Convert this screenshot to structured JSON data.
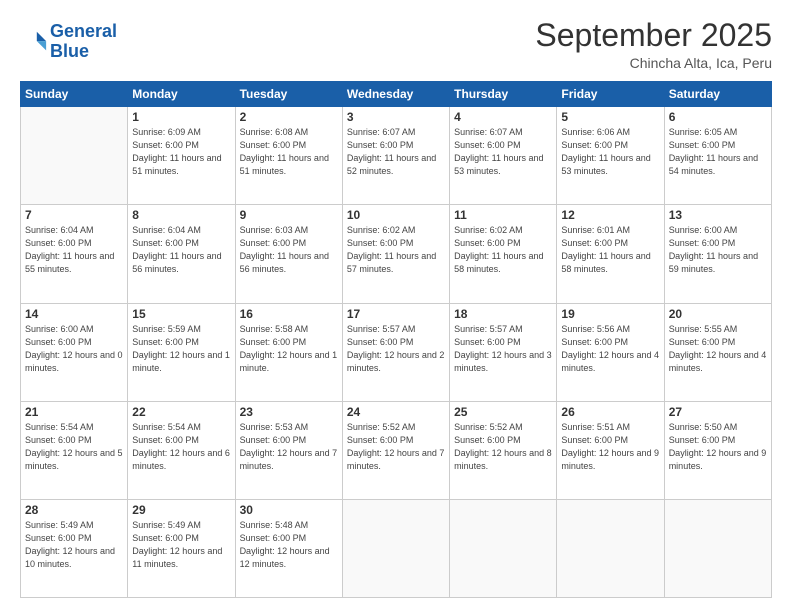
{
  "logo": {
    "line1": "General",
    "line2": "Blue"
  },
  "header": {
    "title": "September 2025",
    "subtitle": "Chincha Alta, Ica, Peru"
  },
  "weekdays": [
    "Sunday",
    "Monday",
    "Tuesday",
    "Wednesday",
    "Thursday",
    "Friday",
    "Saturday"
  ],
  "weeks": [
    [
      {
        "day": "",
        "empty": true
      },
      {
        "day": "1",
        "sunrise": "6:09 AM",
        "sunset": "6:00 PM",
        "daylight": "11 hours and 51 minutes."
      },
      {
        "day": "2",
        "sunrise": "6:08 AM",
        "sunset": "6:00 PM",
        "daylight": "11 hours and 51 minutes."
      },
      {
        "day": "3",
        "sunrise": "6:07 AM",
        "sunset": "6:00 PM",
        "daylight": "11 hours and 52 minutes."
      },
      {
        "day": "4",
        "sunrise": "6:07 AM",
        "sunset": "6:00 PM",
        "daylight": "11 hours and 53 minutes."
      },
      {
        "day": "5",
        "sunrise": "6:06 AM",
        "sunset": "6:00 PM",
        "daylight": "11 hours and 53 minutes."
      },
      {
        "day": "6",
        "sunrise": "6:05 AM",
        "sunset": "6:00 PM",
        "daylight": "11 hours and 54 minutes."
      }
    ],
    [
      {
        "day": "7",
        "sunrise": "6:04 AM",
        "sunset": "6:00 PM",
        "daylight": "11 hours and 55 minutes."
      },
      {
        "day": "8",
        "sunrise": "6:04 AM",
        "sunset": "6:00 PM",
        "daylight": "11 hours and 56 minutes."
      },
      {
        "day": "9",
        "sunrise": "6:03 AM",
        "sunset": "6:00 PM",
        "daylight": "11 hours and 56 minutes."
      },
      {
        "day": "10",
        "sunrise": "6:02 AM",
        "sunset": "6:00 PM",
        "daylight": "11 hours and 57 minutes."
      },
      {
        "day": "11",
        "sunrise": "6:02 AM",
        "sunset": "6:00 PM",
        "daylight": "11 hours and 58 minutes."
      },
      {
        "day": "12",
        "sunrise": "6:01 AM",
        "sunset": "6:00 PM",
        "daylight": "11 hours and 58 minutes."
      },
      {
        "day": "13",
        "sunrise": "6:00 AM",
        "sunset": "6:00 PM",
        "daylight": "11 hours and 59 minutes."
      }
    ],
    [
      {
        "day": "14",
        "sunrise": "6:00 AM",
        "sunset": "6:00 PM",
        "daylight": "12 hours and 0 minutes."
      },
      {
        "day": "15",
        "sunrise": "5:59 AM",
        "sunset": "6:00 PM",
        "daylight": "12 hours and 1 minute."
      },
      {
        "day": "16",
        "sunrise": "5:58 AM",
        "sunset": "6:00 PM",
        "daylight": "12 hours and 1 minute."
      },
      {
        "day": "17",
        "sunrise": "5:57 AM",
        "sunset": "6:00 PM",
        "daylight": "12 hours and 2 minutes."
      },
      {
        "day": "18",
        "sunrise": "5:57 AM",
        "sunset": "6:00 PM",
        "daylight": "12 hours and 3 minutes."
      },
      {
        "day": "19",
        "sunrise": "5:56 AM",
        "sunset": "6:00 PM",
        "daylight": "12 hours and 4 minutes."
      },
      {
        "day": "20",
        "sunrise": "5:55 AM",
        "sunset": "6:00 PM",
        "daylight": "12 hours and 4 minutes."
      }
    ],
    [
      {
        "day": "21",
        "sunrise": "5:54 AM",
        "sunset": "6:00 PM",
        "daylight": "12 hours and 5 minutes."
      },
      {
        "day": "22",
        "sunrise": "5:54 AM",
        "sunset": "6:00 PM",
        "daylight": "12 hours and 6 minutes."
      },
      {
        "day": "23",
        "sunrise": "5:53 AM",
        "sunset": "6:00 PM",
        "daylight": "12 hours and 7 minutes."
      },
      {
        "day": "24",
        "sunrise": "5:52 AM",
        "sunset": "6:00 PM",
        "daylight": "12 hours and 7 minutes."
      },
      {
        "day": "25",
        "sunrise": "5:52 AM",
        "sunset": "6:00 PM",
        "daylight": "12 hours and 8 minutes."
      },
      {
        "day": "26",
        "sunrise": "5:51 AM",
        "sunset": "6:00 PM",
        "daylight": "12 hours and 9 minutes."
      },
      {
        "day": "27",
        "sunrise": "5:50 AM",
        "sunset": "6:00 PM",
        "daylight": "12 hours and 9 minutes."
      }
    ],
    [
      {
        "day": "28",
        "sunrise": "5:49 AM",
        "sunset": "6:00 PM",
        "daylight": "12 hours and 10 minutes."
      },
      {
        "day": "29",
        "sunrise": "5:49 AM",
        "sunset": "6:00 PM",
        "daylight": "12 hours and 11 minutes."
      },
      {
        "day": "30",
        "sunrise": "5:48 AM",
        "sunset": "6:00 PM",
        "daylight": "12 hours and 12 minutes."
      },
      {
        "day": "",
        "empty": true
      },
      {
        "day": "",
        "empty": true
      },
      {
        "day": "",
        "empty": true
      },
      {
        "day": "",
        "empty": true
      }
    ]
  ]
}
